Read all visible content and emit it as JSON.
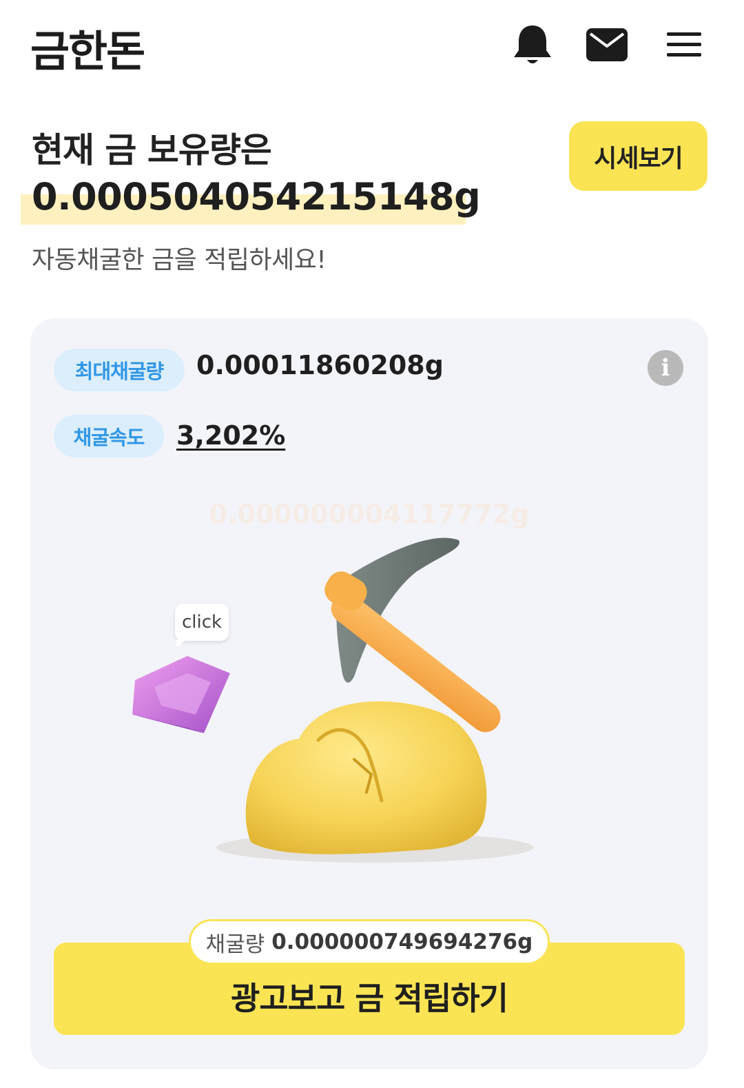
{
  "header": {
    "logo": "금한돈",
    "icons": [
      "bell-icon",
      "mail-icon",
      "menu-icon"
    ]
  },
  "balance": {
    "title": "현재 금 보유량은",
    "value": "0.000504054215148g",
    "subtitle": "자동채굴한 금을 적립하세요!"
  },
  "price_button": {
    "label": "시세보기"
  },
  "mining": {
    "max_label": "최대채굴량",
    "max_value": "0.00011860208g",
    "speed_label": "채굴속도",
    "speed_value": "3,202%",
    "info_label": "i",
    "floating_value": "0.000000004117772g",
    "click_hint": "click",
    "mined_label": "채굴량",
    "mined_value": "0.000000749694276g",
    "ad_button_label": "광고보고 금 적립하기"
  },
  "colors": {
    "accent_yellow": "#fae454",
    "highlight": "#fff1bf",
    "chip_bg": "#dceefc",
    "chip_text": "#2f97e6",
    "card_bg": "#f3f4f9"
  }
}
